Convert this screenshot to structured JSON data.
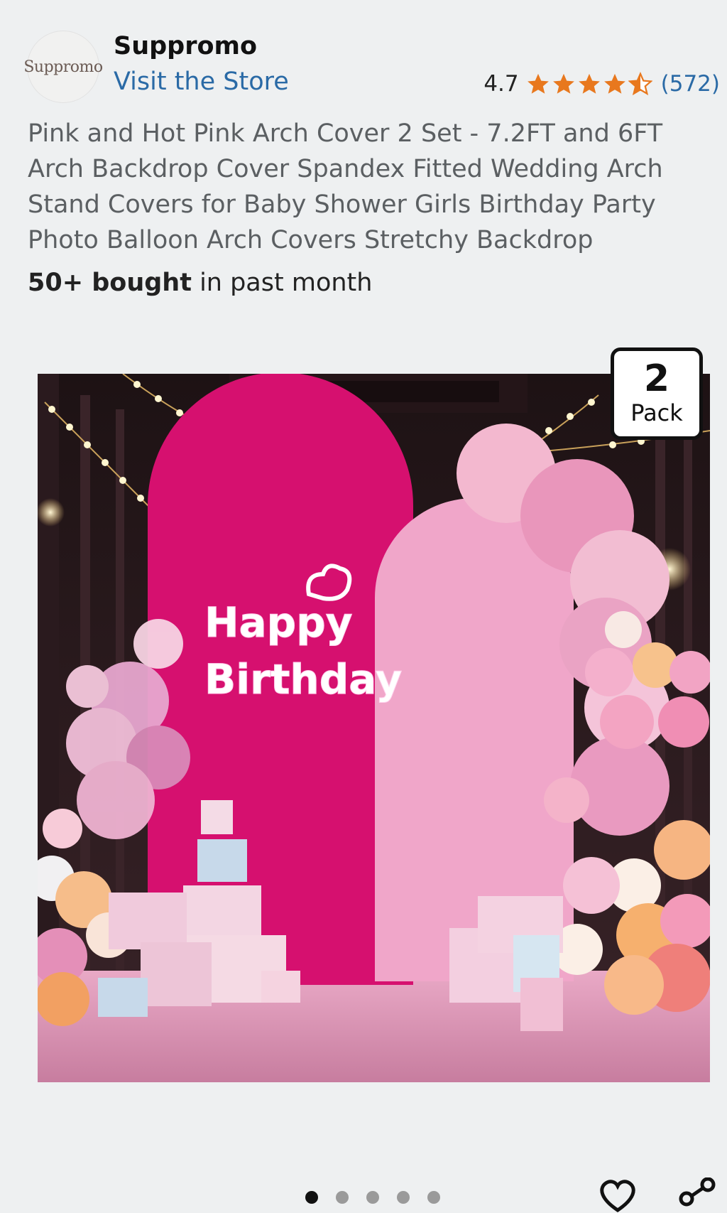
{
  "store": {
    "logo_text": "Suppromo",
    "name": "Suppromo",
    "link_label": "Visit the Store"
  },
  "rating": {
    "value": "4.7",
    "stars": 4.5,
    "count": "(572)",
    "star_color": "#e8781e"
  },
  "product": {
    "title": "Pink and Hot Pink Arch Cover 2 Set - 7.2FT and 6FT Arch Backdrop Cover Spandex Fitted Wedding Arch Stand Covers for Baby Shower Girls Birthday Party Photo Balloon Arch Covers Stretchy Backdrop",
    "bought_bold": "50+ bought",
    "bought_rest": " in past month"
  },
  "image": {
    "neon_line1": "Happy",
    "neon_line2": "Birthday",
    "badge_number": "2",
    "badge_label": "Pack",
    "hot_pink": "#d6106f",
    "light_pink": "#f0a6c9"
  },
  "carousel": {
    "total_dots": 5,
    "active_index": 0
  },
  "icons": {
    "wish": "heart-icon",
    "share": "share-icon"
  }
}
